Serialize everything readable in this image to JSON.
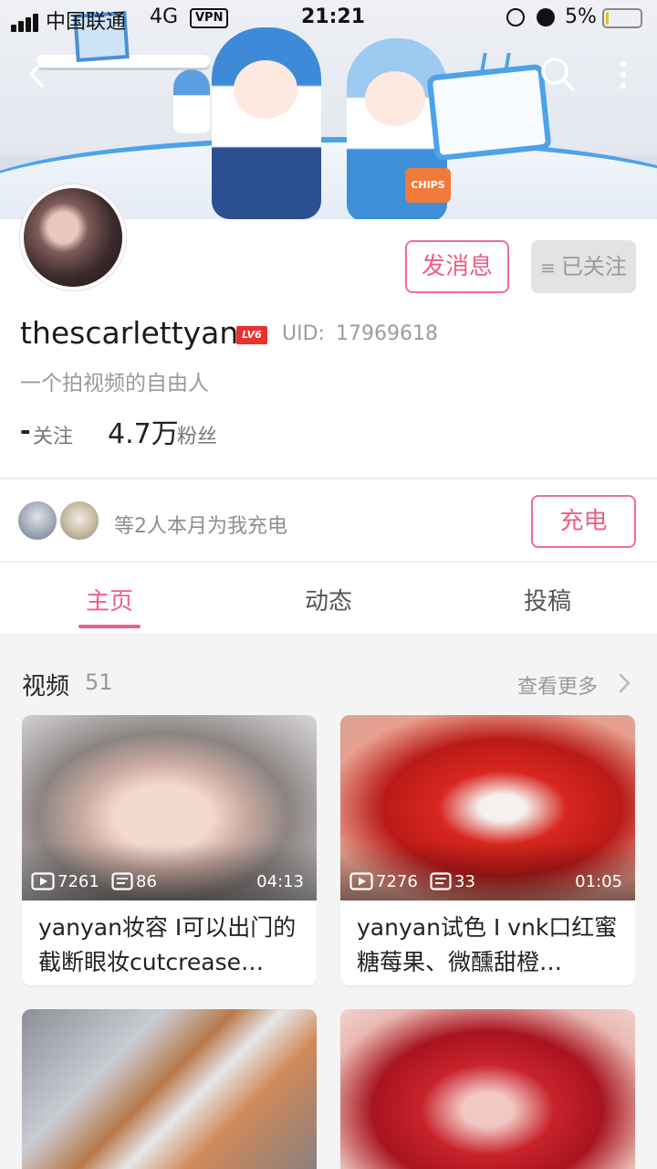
{
  "status_bar": {
    "carrier": "中国联通",
    "network": "4G",
    "vpn": "VPN",
    "time": "21:21",
    "battery_percent": "5%",
    "battery_level": 0.05
  },
  "profile": {
    "username": "thescarlettyan",
    "level": "LV6",
    "uid_label": "UID:",
    "uid": "17969618",
    "bio": "一个拍视频的自由人",
    "following_count": "-",
    "following_label": "关注",
    "fans_count": "4.7万",
    "fans_label": "粉丝",
    "message_button": "发消息",
    "followed_button": "已关注"
  },
  "charge": {
    "text": "等2人本月为我充电",
    "button": "充电"
  },
  "tabs": [
    {
      "label": "主页",
      "active": true
    },
    {
      "label": "动态",
      "active": false
    },
    {
      "label": "投稿",
      "active": false
    }
  ],
  "videos": {
    "title": "视频",
    "count": "51",
    "see_more": "查看更多",
    "items": [
      {
        "plays": "7261",
        "comments": "86",
        "duration": "04:13",
        "title": "yanyan妆容 Ⅰ可以出门的截断眼妆cutcrease…"
      },
      {
        "plays": "7276",
        "comments": "33",
        "duration": "01:05",
        "title": "yanyan试色 Ⅰ vnk口红蜜糖莓果、微醺甜橙…"
      }
    ]
  },
  "colors": {
    "accent_pink": "#ee5e86",
    "level_badge": "#e8322e",
    "battery": "#e5c31e"
  },
  "icons": [
    "back-icon",
    "search-icon",
    "more-icon",
    "menu-icon",
    "play-count-icon",
    "comment-count-icon",
    "chevron-right-icon"
  ]
}
